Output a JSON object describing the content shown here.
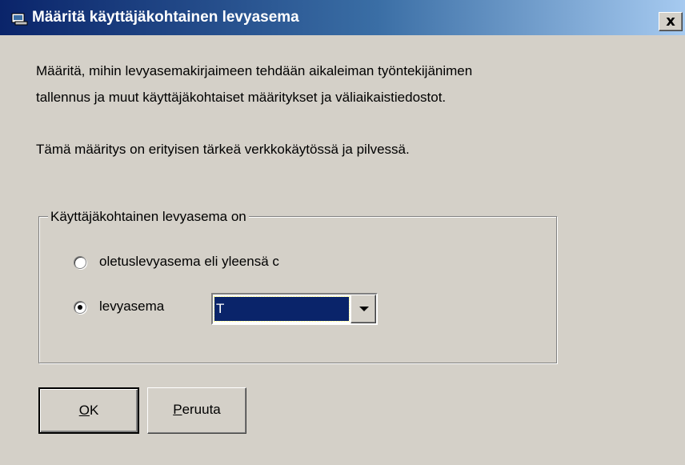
{
  "window": {
    "title": "Määritä käyttäjäkohtainen levyasema",
    "close_label": "x"
  },
  "description": {
    "line1": "Määritä, mihin levyasemakirjaimeen tehdään aikaleiman työntekijänimen",
    "line2": "tallennus ja muut käyttäjäkohtaiset määritykset ja väliaikaistiedostot.",
    "line3": "Tämä määritys on erityisen tärkeä verkkokäytössä ja pilvessä."
  },
  "group": {
    "legend": "Käyttäjäkohtainen levyasema on",
    "options": [
      {
        "label": "oletuslevyasema eli yleensä c",
        "selected": false
      },
      {
        "label": "levyasema",
        "selected": true
      }
    ],
    "drive_select": {
      "value": "T"
    }
  },
  "buttons": {
    "ok": {
      "mnemonic": "O",
      "rest": "K"
    },
    "cancel": {
      "mnemonic": "P",
      "rest": "eruuta"
    }
  }
}
